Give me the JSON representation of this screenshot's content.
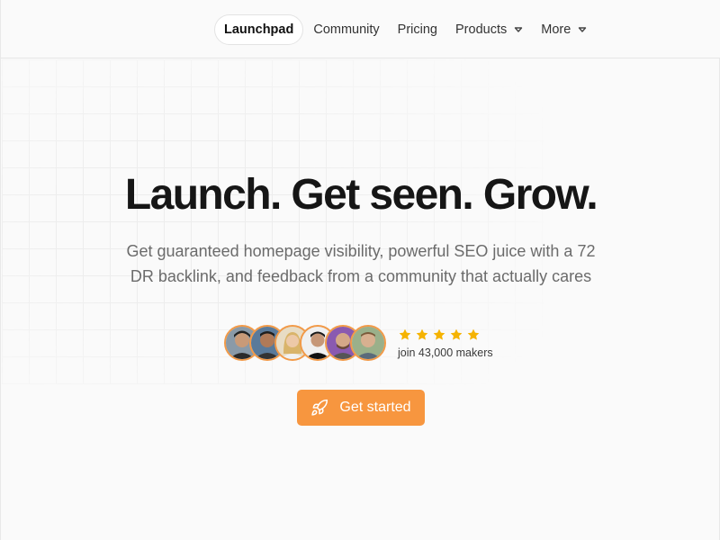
{
  "nav": {
    "items": [
      {
        "label": "Launchpad",
        "active": true,
        "dropdown": false
      },
      {
        "label": "Community",
        "active": false,
        "dropdown": false
      },
      {
        "label": "Pricing",
        "active": false,
        "dropdown": false
      },
      {
        "label": "Products",
        "active": false,
        "dropdown": true
      },
      {
        "label": "More",
        "active": false,
        "dropdown": true
      }
    ]
  },
  "hero": {
    "title": "Launch. Get seen. Grow.",
    "subtitle_line1": "Get guaranteed homepage visibility, powerful SEO juice with a 72",
    "subtitle_line2": "DR backlink, and feedback from a community that actually cares"
  },
  "social_proof": {
    "avatar_count": 6,
    "rating_stars": 5,
    "makers_text": "join 43,000 makers"
  },
  "cta": {
    "label": "Get started",
    "icon": "rocket-icon"
  },
  "colors": {
    "accent": "#f7963f",
    "star": "#f5b301",
    "avatar_ring": "#f29a48"
  }
}
